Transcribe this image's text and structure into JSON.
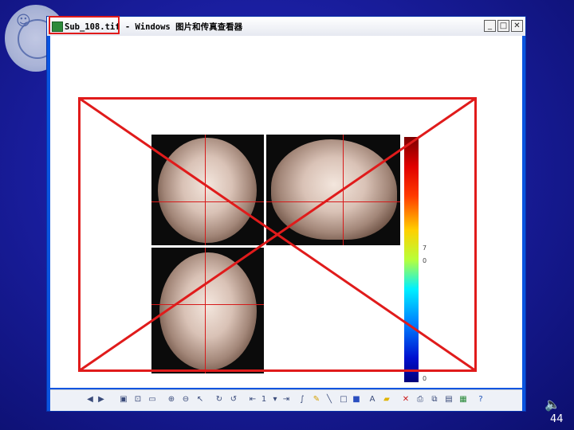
{
  "window": {
    "title": "Sub_108.tif - Windows 图片和传真查看器",
    "min_label": "_",
    "max_label": "□",
    "close_label": "✕"
  },
  "viewer": {
    "colorbar_labels": [
      "7",
      "0",
      "0"
    ]
  },
  "toolbar": {
    "page_indicator": "1"
  },
  "slide": {
    "page_number": "44"
  },
  "colors": {
    "annotation_red": "#e01b1b",
    "title_bar": "#ffffff",
    "window_frame": "#0a54e0"
  }
}
